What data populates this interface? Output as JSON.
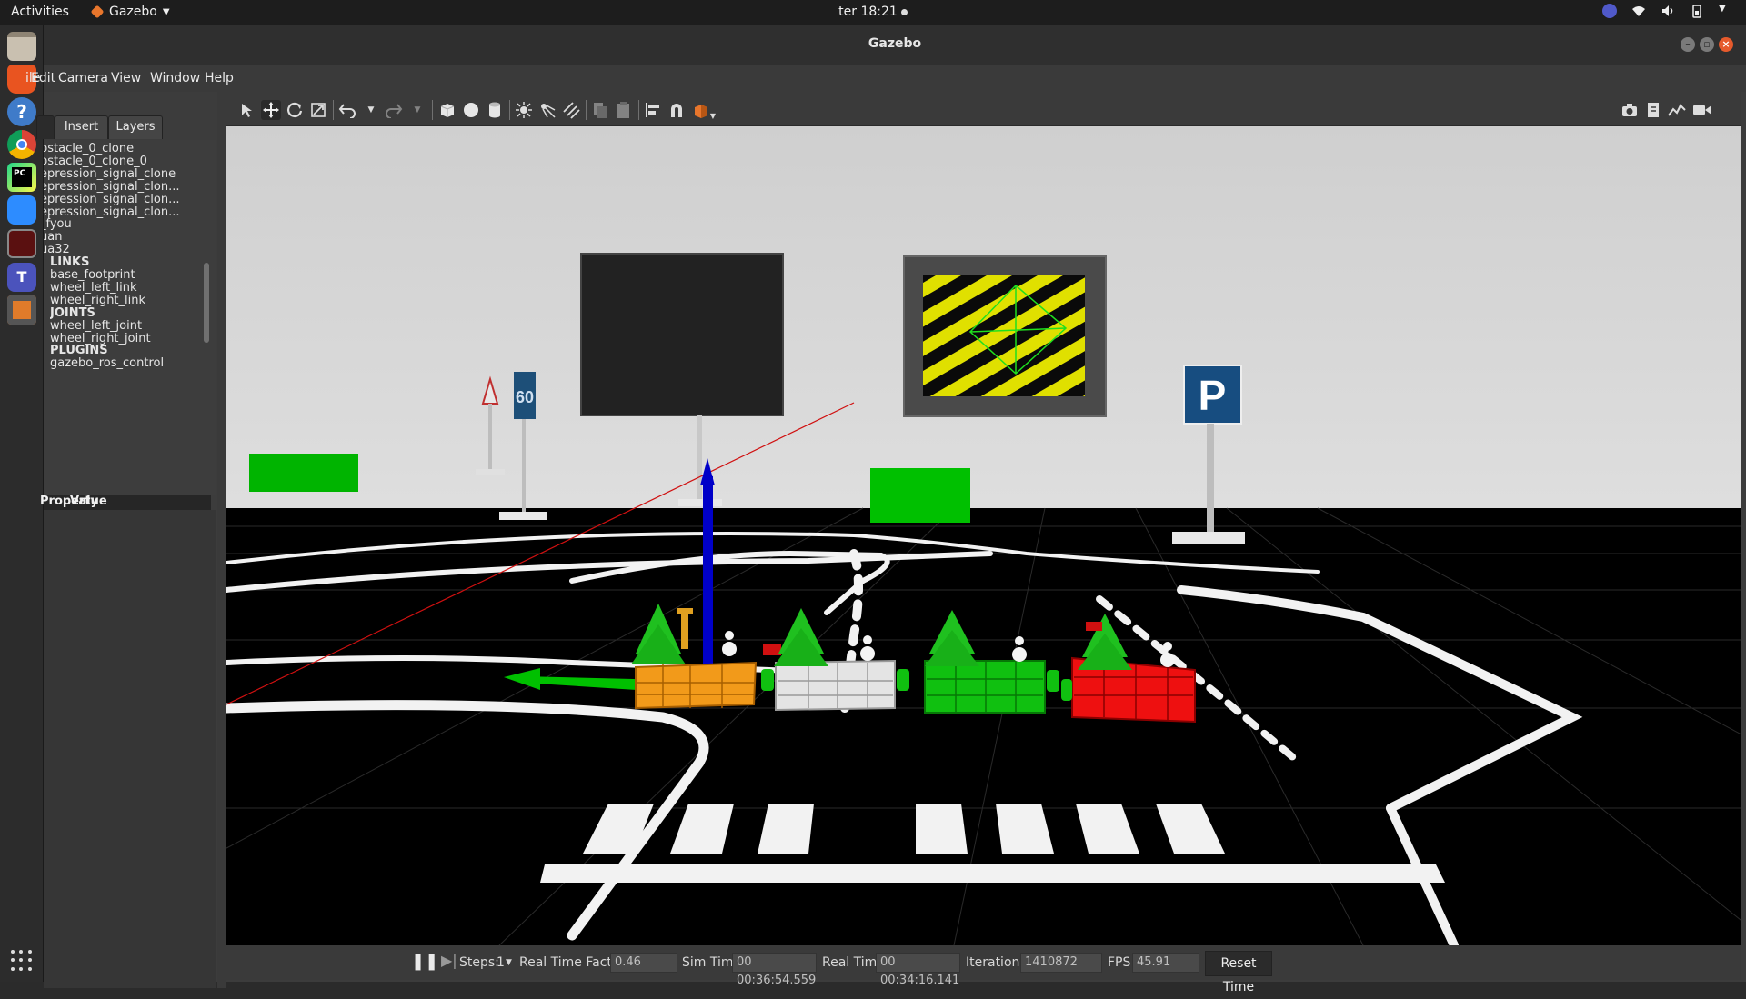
{
  "topbar": {
    "activities": "Activities",
    "app_name": "Gazebo",
    "clock": "ter 18:21"
  },
  "window": {
    "title": "Gazebo"
  },
  "menu": [
    "Edit",
    "Camera",
    "View",
    "Window",
    "Help"
  ],
  "left_panel": {
    "tabs": [
      "Insert",
      "Layers"
    ],
    "tree": [
      {
        "text": "bstacle_0_clone",
        "kind": "item"
      },
      {
        "text": "bstacle_0_clone_0",
        "kind": "item"
      },
      {
        "text": "epression_signal_clone",
        "kind": "item"
      },
      {
        "text": "epression_signal_clon...",
        "kind": "item"
      },
      {
        "text": "epression_signal_clon...",
        "kind": "item"
      },
      {
        "text": "epression_signal_clon...",
        "kind": "item"
      },
      {
        "text": "_fyou",
        "kind": "item"
      },
      {
        "text": "uan",
        "kind": "item"
      },
      {
        "text": "ua32",
        "kind": "item"
      },
      {
        "text": "LINKS",
        "kind": "section"
      },
      {
        "text": "base_footprint",
        "kind": "child"
      },
      {
        "text": "wheel_left_link",
        "kind": "child"
      },
      {
        "text": "wheel_right_link",
        "kind": "child"
      },
      {
        "text": "JOINTS",
        "kind": "section"
      },
      {
        "text": "wheel_left_joint",
        "kind": "child"
      },
      {
        "text": "wheel_right_joint",
        "kind": "child"
      },
      {
        "text": "PLUGINS",
        "kind": "section"
      },
      {
        "text": "gazebo_ros_control",
        "kind": "child"
      }
    ],
    "property_header": {
      "property": "Property",
      "value": "Value"
    }
  },
  "toolbar": {
    "tools": [
      "select-icon",
      "translate-icon",
      "rotate-icon",
      "scale-icon",
      "undo-icon",
      "undo-dropdown-icon",
      "redo-icon",
      "redo-dropdown-icon",
      "box-icon",
      "sphere-icon",
      "cylinder-icon",
      "point-light-icon",
      "spot-light-icon",
      "directional-light-icon",
      "copy-icon",
      "paste-icon",
      "align-icon",
      "snap-icon",
      "view-angle-icon"
    ],
    "right_tools": [
      "screenshot-icon",
      "log-icon",
      "plot-icon",
      "video-record-icon"
    ]
  },
  "timebar": {
    "steps_label": "Steps:",
    "steps_value": "1",
    "rtf_label": "Real Time Factor:",
    "rtf_value": "0.46",
    "sim_label": "Sim Time:",
    "sim_value": "00 00:36:54.559",
    "real_label": "Real Time:",
    "real_value": "00 00:34:16.141",
    "iter_label": "Iterations:",
    "iter_value": "1410872",
    "fps_label": "FPS:",
    "fps_value": "45.91",
    "reset_label": "Reset Time"
  },
  "scene": {
    "speed_sign": "60",
    "parking_sign": "P"
  },
  "colors": {
    "accent": "#e95420",
    "ground": "#000000",
    "wall": "#d6d6d6",
    "obstacle_green": "#00c000"
  }
}
